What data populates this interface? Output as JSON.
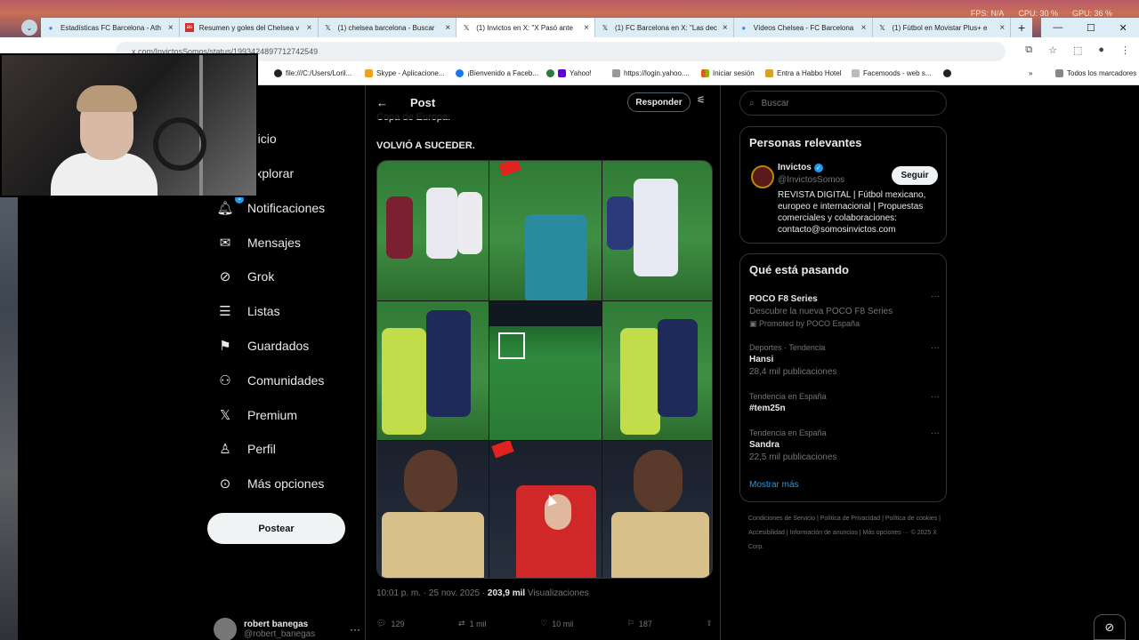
{
  "browser": {
    "tabs": [
      {
        "title": "Estadísticas FC Barcelona - Ath",
        "favicon": "google-icon",
        "active": false
      },
      {
        "title": "Resumen y goles del Chelsea v",
        "favicon": "as-icon",
        "active": false
      },
      {
        "title": "(1) chelsea barcelona - Buscar",
        "favicon": "x-icon",
        "active": false
      },
      {
        "title": "(1) Invictos en X: \"X Pasó ante",
        "favicon": "x-icon",
        "active": true
      },
      {
        "title": "(1) FC Barcelona en X: \"Las dec",
        "favicon": "x-icon",
        "active": false
      },
      {
        "title": "Vídeos Chelsea - FC Barcelona",
        "favicon": "google-icon",
        "active": false
      },
      {
        "title": "(1) Fútbol en Movistar Plus+ e",
        "favicon": "x-icon",
        "active": false
      }
    ],
    "stats": [
      "FPS: N/A",
      "CPU: 30 %",
      "GPU: 36 %"
    ],
    "address": "x.com/InvictosSomos/status/1993424897712742549",
    "bookmarks": [
      "file:///C:/Users/Loril...",
      "Skype - Aplicacione...",
      "¡Bienvenido a Faceb...",
      "Yahoo!",
      "https://login.yahoo....",
      "Iniciar sesión",
      "Entra a Habbo Hotel",
      "Facemoods - web s..."
    ],
    "all_bookmarks": "Todos los marcadores"
  },
  "nav": {
    "items": [
      {
        "label": "Inicio",
        "icon": "home-icon"
      },
      {
        "label": "Explorar",
        "icon": "search-icon"
      },
      {
        "label": "Notificaciones",
        "icon": "bell-icon",
        "badge": "1"
      },
      {
        "label": "Mensajes",
        "icon": "mail-icon"
      },
      {
        "label": "Grok",
        "icon": "grok-icon"
      },
      {
        "label": "Listas",
        "icon": "list-icon"
      },
      {
        "label": "Guardados",
        "icon": "bookmark-icon"
      },
      {
        "label": "Comunidades",
        "icon": "communities-icon"
      },
      {
        "label": "Premium",
        "icon": "x-logo-icon"
      },
      {
        "label": "Perfil",
        "icon": "user-icon"
      },
      {
        "label": "Más opciones",
        "icon": "more-circle-icon"
      }
    ],
    "post_button": "Postear",
    "account": {
      "name": "robert banegas",
      "handle": "@robert_banegas"
    }
  },
  "post": {
    "header_title": "Post",
    "reply_label": "Responder",
    "prev_line": "Copa de Europa.",
    "headline": "VOLVIÓ A SUCEDER.",
    "timestamp": "10:01 p. m. · 25 nov. 2025 · ",
    "views_count": "203,9 mil",
    "views_label": " Visualizaciones",
    "stats": {
      "replies": "129",
      "reposts": "1 mil",
      "likes": "10 mil",
      "bookmarks": "187"
    }
  },
  "sidebar": {
    "search_placeholder": "Buscar",
    "relevant": {
      "title": "Personas relevantes",
      "name": "Invictos",
      "handle": "@InvictosSomos",
      "follow": "Seguir",
      "bio": "REVISTA DIGITAL | Fútbol mexicano, europeo e internacional | Propuestas comerciales y colaboraciones: contacto@somosinvictos.com"
    },
    "trends_title": "Qué está pasando",
    "trends": [
      {
        "context": "",
        "title": "POCO F8 Series",
        "sub": "Descubre la nueva POCO F8 Series",
        "extra": "Promoted by POCO España"
      },
      {
        "context": "Deportes · Tendencia",
        "title": "Hansi",
        "sub": "28,4 mil publicaciones"
      },
      {
        "context": "Tendencia en España",
        "title": "#tem25n",
        "sub": ""
      },
      {
        "context": "Tendencia en España",
        "title": "Sandra",
        "sub": "22,5 mil publicaciones"
      }
    ],
    "show_more": "Mostrar más",
    "footer": "Condiciones de Servicio | Política de Privacidad | Política de cookies | Accesibilidad | Información de anuncios | Más opciones ··· © 2025 X Corp."
  }
}
